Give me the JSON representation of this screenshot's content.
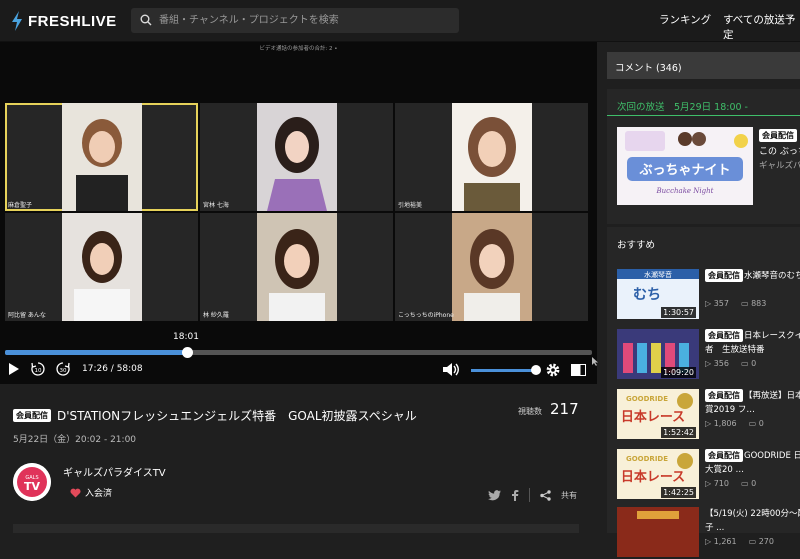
{
  "header": {
    "logo_text": "FRESHLIVE",
    "search_placeholder": "番組・チャンネル・プロジェクトを検索",
    "nav": [
      "ランキング",
      "すべての放送予定"
    ]
  },
  "player": {
    "top_note": "ビデオ通話の参加者の合計: 2 •",
    "participants": [
      "麻倉聖子",
      "宮林 七海",
      "引地裕美",
      "阿比留 あんな",
      "林 紗久羅",
      "こっちっちのiPhone"
    ],
    "active_index": 0,
    "seek_tooltip": "18:01",
    "seek_progress": 0.31,
    "time_display": "17:26 / 58:08",
    "volume_level": 0.95
  },
  "program": {
    "badge": "会員配信",
    "title": "D'STATIONフレッシュエンジェルズ特番　GOAL初披露スペシャル",
    "date": "5月22日（金）20:02 - 21:00",
    "views_label": "視聴数",
    "views": "217",
    "channel_name": "ギャルズパラダイスTV",
    "joined_label": "入会済",
    "share_label": "共有"
  },
  "sidebar": {
    "comments_label": "コメント (346)",
    "next": {
      "heading": "次回の放送　5月29日 18:00 -",
      "badge": "会員配信",
      "title": "この ぶっち…",
      "channel": "ギャルズパ…"
    },
    "recommend_heading": "おすすめ",
    "items": [
      {
        "badge": "会員配信",
        "title": "水瀬琴音のむち",
        "title2": "",
        "duration": "1:30:57",
        "views": "357",
        "comments": "883",
        "color": "#2b5fa8"
      },
      {
        "badge": "会員配信",
        "title": "日本レースクイ",
        "title2": "者　生放送特番",
        "duration": "1:09:20",
        "views": "356",
        "comments": "0",
        "color": "#3a3a7a"
      },
      {
        "badge": "会員配信",
        "title": "【再放送】日本",
        "title2": "賞2019 フ…",
        "duration": "1:52:42",
        "views": "1,806",
        "comments": "0",
        "color": "#c9a63a"
      },
      {
        "badge": "会員配信",
        "title": "GOODRIDE 日本",
        "title2": "大賞20 …",
        "duration": "1:42:25",
        "views": "710",
        "comments": "0",
        "color": "#c9a63a"
      },
      {
        "badge": "",
        "title": "",
        "title2": "【5/19(火) 22時00分～配信",
        "title3": "子 ...",
        "duration": "",
        "views": "1,261",
        "comments": "270",
        "color": "#8a2a1a"
      }
    ]
  }
}
